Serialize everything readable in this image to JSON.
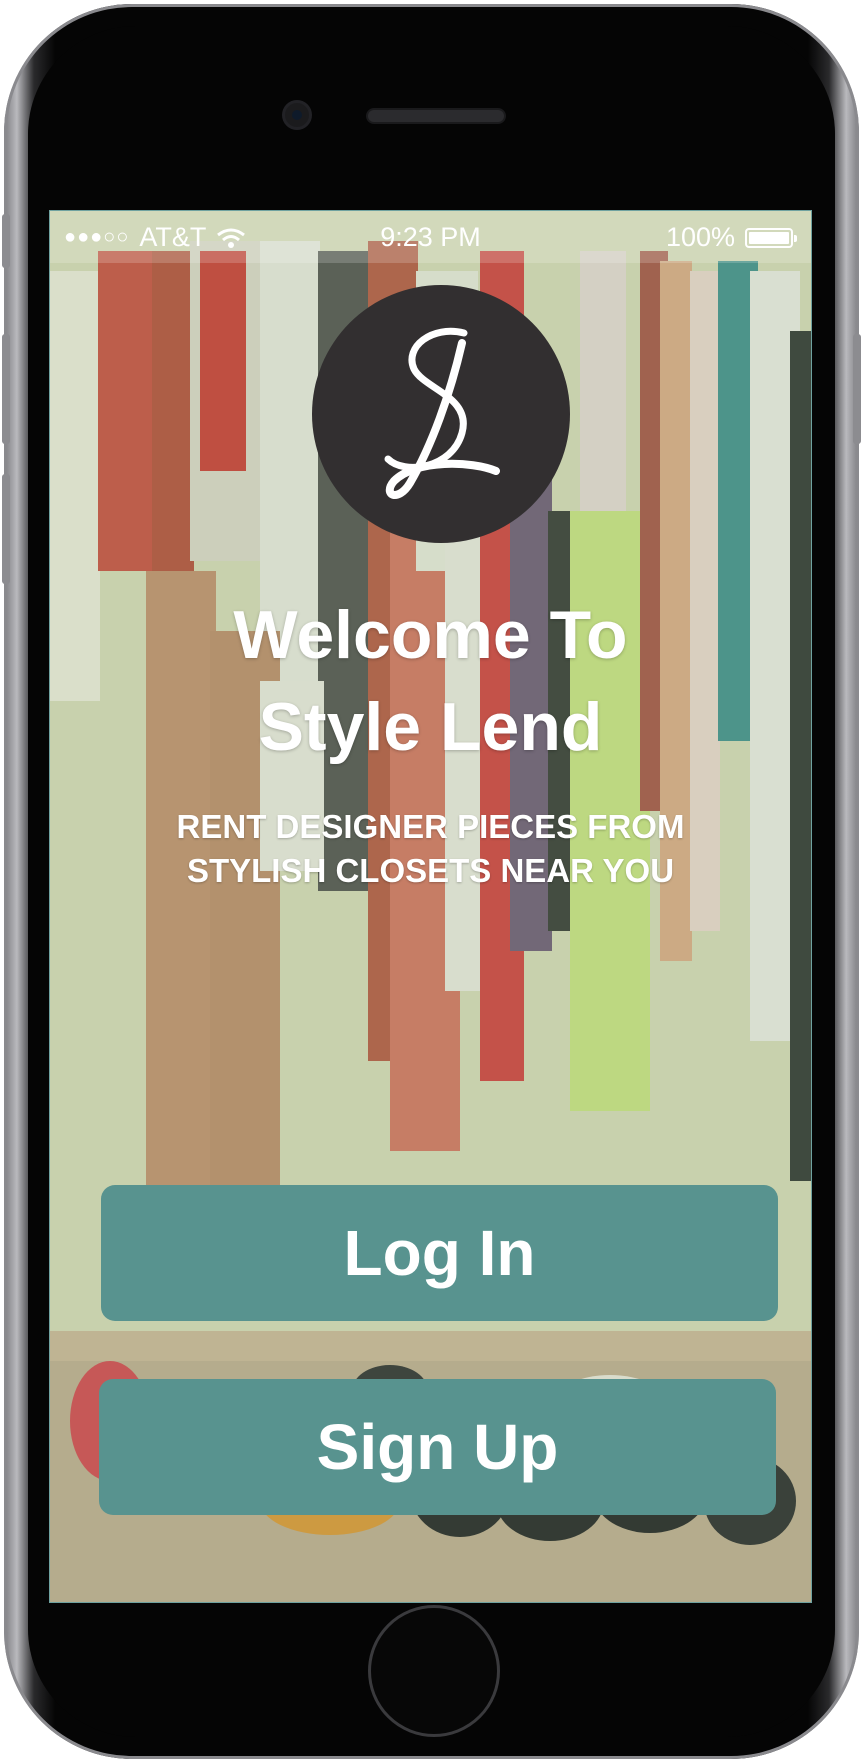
{
  "status_bar": {
    "signal_dots": "●●●○○",
    "carrier": "AT&T",
    "time": "9:23 PM",
    "battery_percent": "100%",
    "battery_level": 1.0
  },
  "brand": {
    "logo_text": "SL",
    "logo_color": "#322f30"
  },
  "welcome": {
    "title_line1": "Welcome To",
    "title_line2": "Style Lend",
    "subtitle_line1": "RENT DESIGNER PIECES FROM",
    "subtitle_line2": "STYLISH CLOSETS NEAR YOU"
  },
  "actions": {
    "login_label": "Log In",
    "signup_label": "Sign Up",
    "button_color": "#58938f"
  }
}
